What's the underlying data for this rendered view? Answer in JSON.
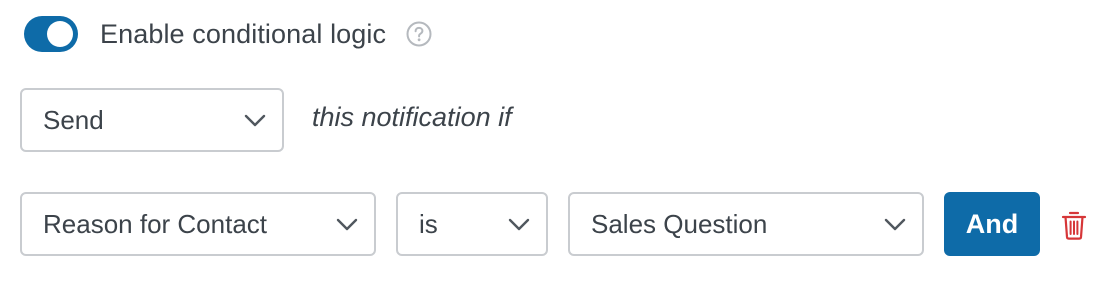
{
  "toggle": {
    "enabled": true,
    "label": "Enable conditional logic",
    "accent_color": "#0e6ba8",
    "help_icon": "question-circle-icon"
  },
  "action": {
    "selected": "Send",
    "suffix_text": "this notification if"
  },
  "rule": {
    "field": "Reason for Contact",
    "operator": "is",
    "value": "Sales Question",
    "and_label": "And",
    "delete_icon": "trash-icon",
    "delete_color": "#d63638"
  }
}
